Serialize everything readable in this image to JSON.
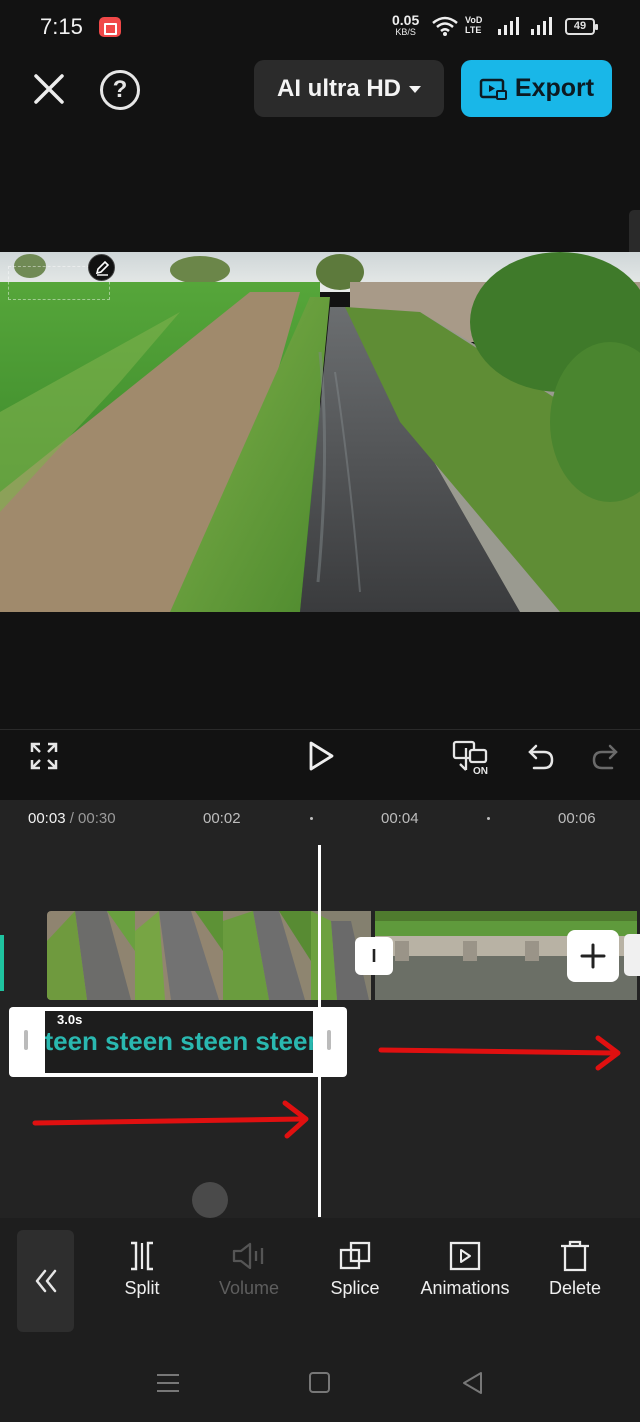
{
  "status_bar": {
    "time": "7:15",
    "net_speed_value": "0.05",
    "net_speed_unit": "KB/S",
    "volte_top": "VoD",
    "volte_bottom": "LTE",
    "battery_level": "49"
  },
  "header": {
    "quality_label": "AI ultra HD",
    "export_label": "Export"
  },
  "timeline": {
    "current_time": "00:03",
    "total_time": "/ 00:30",
    "ruler": [
      "00:02",
      "00:04",
      "00:06"
    ],
    "transition_label": "I",
    "text_clip": {
      "duration": "3.0s",
      "content": "steen steen steen steen"
    }
  },
  "toolbar": {
    "items": [
      {
        "label": "Split",
        "icon": "split-icon",
        "enabled": true
      },
      {
        "label": "Volume",
        "icon": "volume-icon",
        "enabled": false
      },
      {
        "label": "Splice",
        "icon": "splice-icon",
        "enabled": true
      },
      {
        "label": "Animations",
        "icon": "animations-icon",
        "enabled": true
      },
      {
        "label": "Delete",
        "icon": "delete-icon",
        "enabled": true
      }
    ]
  },
  "colors": {
    "accent": "#19b7e8",
    "background": "#121212",
    "annotation_arrow": "#e01010",
    "text_clip_text": "#2ab8b0"
  }
}
